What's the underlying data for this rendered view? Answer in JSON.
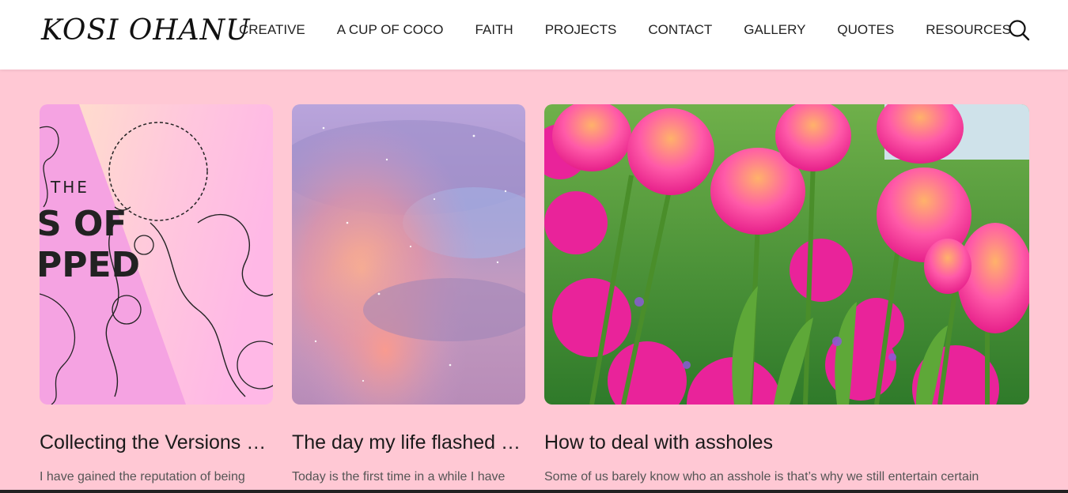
{
  "site": {
    "logo": "KOSI OHANU"
  },
  "nav": {
    "items": [
      {
        "label": "CREATIVE"
      },
      {
        "label": "A CUP OF COCO"
      },
      {
        "label": "FAITH"
      },
      {
        "label": "PROJECTS"
      },
      {
        "label": "CONTACT"
      },
      {
        "label": "GALLERY"
      },
      {
        "label": "QUOTES"
      },
      {
        "label": "RESOURCES"
      }
    ],
    "search_icon": "search-icon"
  },
  "posts": [
    {
      "title": "Collecting the Versions of Me",
      "excerpt": "I have gained the reputation of being",
      "image_text": [
        "THE",
        "S OF",
        "PPED"
      ]
    },
    {
      "title": "The day my life flashed before my eyes",
      "excerpt": "Today is the first time in a while I have"
    },
    {
      "title": "How to deal with assholes",
      "excerpt": "Some of us barely know who an asshole is that’s why we still entertain certain"
    }
  ],
  "colors": {
    "background": "#ffc8d4",
    "header": "#ffffff",
    "text": "#1a1a1a"
  }
}
